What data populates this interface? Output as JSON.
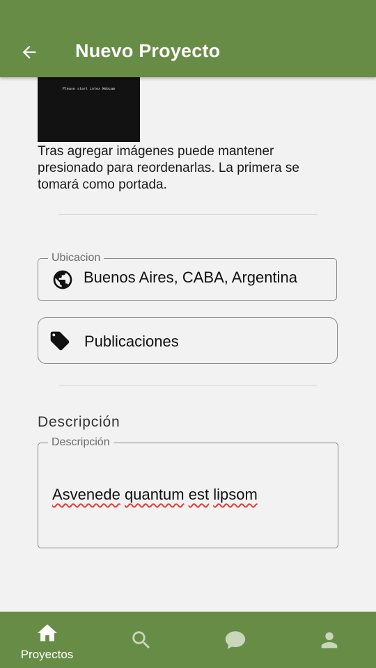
{
  "app_bar": {
    "title": "Nuevo Proyecto",
    "back_icon": "arrow-left-icon"
  },
  "image_preview": {
    "webcam_text": "Please start intex Webcam"
  },
  "help_text": "Tras agregar imágenes puede mantener presionado para reordenarlas. La primera se tomará como portada.",
  "location": {
    "label": "Ubicacion",
    "value": "Buenos Aires, CABA, Argentina",
    "icon": "globe-icon"
  },
  "publications": {
    "label": "Publicaciones",
    "icon": "tag-icon"
  },
  "description": {
    "section_title": "Descripción",
    "field_label": "Descripción",
    "value_words": [
      "Asvenede",
      "quantum",
      "est",
      "lipsom"
    ]
  },
  "bottom_nav": {
    "items": [
      {
        "label": "Proyectos",
        "icon": "home-icon",
        "active": true
      },
      {
        "label": "",
        "icon": "search-icon",
        "active": false
      },
      {
        "label": "",
        "icon": "chat-icon",
        "active": false
      },
      {
        "label": "",
        "icon": "person-icon",
        "active": false
      }
    ]
  },
  "colors": {
    "primary": "#678c46",
    "background": "#f2f2f2",
    "inactive_icon": "#c9d6bb",
    "spellcheck": "#e53935"
  }
}
